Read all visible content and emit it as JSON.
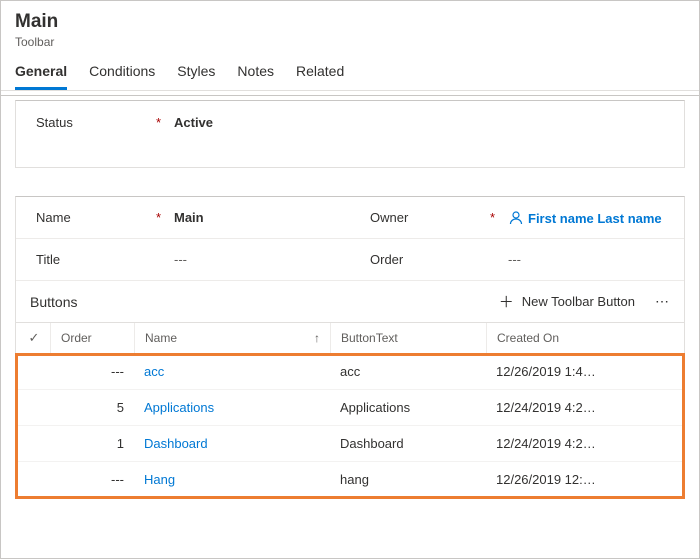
{
  "header": {
    "title": "Main",
    "subtitle": "Toolbar"
  },
  "tabs": {
    "general": "General",
    "conditions": "Conditions",
    "styles": "Styles",
    "notes": "Notes",
    "related": "Related"
  },
  "status": {
    "label": "Status",
    "value": "Active"
  },
  "form": {
    "name_label": "Name",
    "name_value": "Main",
    "owner_label": "Owner",
    "owner_value": "First name Last name",
    "title_label": "Title",
    "title_value": "---",
    "order_label": "Order",
    "order_value": "---"
  },
  "buttons_section": {
    "label": "Buttons",
    "new_button": "New Toolbar Button",
    "columns": {
      "order": "Order",
      "name": "Name",
      "btext": "ButtonText",
      "created": "Created On"
    },
    "rows": [
      {
        "order": "---",
        "name": "acc",
        "btext": "acc",
        "created": "12/26/2019 1:4…"
      },
      {
        "order": "5",
        "name": "Applications",
        "btext": "Applications",
        "created": "12/24/2019 4:2…"
      },
      {
        "order": "1",
        "name": "Dashboard",
        "btext": "Dashboard",
        "created": "12/24/2019 4:2…"
      },
      {
        "order": "---",
        "name": "Hang",
        "btext": "hang",
        "created": "12/26/2019 12:…"
      }
    ]
  }
}
